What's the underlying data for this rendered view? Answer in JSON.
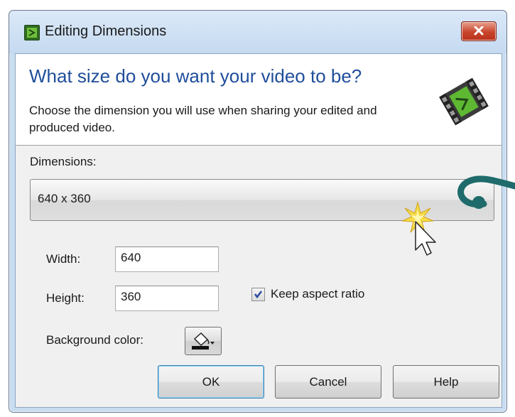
{
  "window": {
    "title": "Editing Dimensions",
    "app_icon": "film-icon",
    "close_icon": "close-icon"
  },
  "header": {
    "heading": "What size do you want your video to be?",
    "description": "Choose the dimension you will use when sharing your edited and produced video."
  },
  "dimensions": {
    "label": "Dimensions:",
    "selected": "640 x 360"
  },
  "width": {
    "label": "Width:",
    "value": "640"
  },
  "height": {
    "label": "Height:",
    "value": "360"
  },
  "keep_aspect": {
    "label": "Keep aspect ratio",
    "checked": true
  },
  "background": {
    "label": "Background color:",
    "icon": "paint-bucket-icon"
  },
  "buttons": {
    "ok": "OK",
    "cancel": "Cancel",
    "help": "Help"
  },
  "colors": {
    "heading": "#1f4e9a",
    "accent_arrow": "#1f6b6b",
    "close_button": "#c8442b"
  }
}
